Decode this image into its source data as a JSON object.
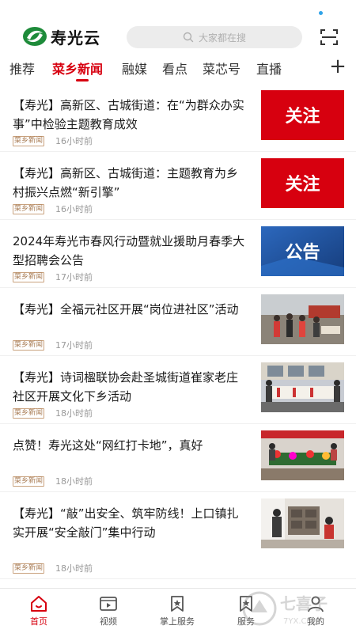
{
  "header": {
    "logo_text": "寿光云",
    "search_placeholder": "大家都在搜"
  },
  "tabs": [
    {
      "label": "推荐",
      "active": false
    },
    {
      "label": "菜乡新闻",
      "active": true
    },
    {
      "label": "融媒",
      "active": false
    },
    {
      "label": "看点",
      "active": false
    },
    {
      "label": "菜芯号",
      "active": false
    },
    {
      "label": "直播",
      "active": false
    }
  ],
  "news": [
    {
      "title": "【寿光】高新区、古城街道：在“为群众办实事”中检验主题教育成效",
      "tag": "菜乡新闻",
      "time": "16小时前",
      "thumb_text": "关注"
    },
    {
      "title": "【寿光】高新区、古城街道：主题教育为乡村振兴点燃“新引擎”",
      "tag": "菜乡新闻",
      "time": "16小时前",
      "thumb_text": "关注"
    },
    {
      "title": "2024年寿光市春风行动暨就业援助月春季大型招聘会公告",
      "tag": "菜乡新闻",
      "time": "17小时前",
      "thumb_text": "公告"
    },
    {
      "title": "【寿光】全福元社区开展“岗位进社区”活动",
      "tag": "菜乡新闻",
      "time": "17小时前",
      "thumb_text": ""
    },
    {
      "title": "【寿光】诗词楹联协会赴圣城街道崔家老庄社区开展文化下乡活动",
      "tag": "菜乡新闻",
      "time": "18小时前",
      "thumb_text": ""
    },
    {
      "title": "点赞！寿光这处“网红打卡地”，真好",
      "tag": "菜乡新闻",
      "time": "18小时前",
      "thumb_text": ""
    },
    {
      "title": "【寿光】“敲”出安全、筑牢防线！上口镇扎实开展“安全敲门”集中行动",
      "tag": "菜乡新闻",
      "time": "18小时前",
      "thumb_text": ""
    }
  ],
  "bottom_nav": [
    {
      "label": "首页",
      "active": true
    },
    {
      "label": "视频",
      "active": false
    },
    {
      "label": "掌上服务",
      "active": false
    },
    {
      "label": "服务",
      "active": false
    },
    {
      "label": "我的",
      "active": false
    }
  ],
  "watermark": "七喜子",
  "watermark_url": "7YX.COM",
  "colors": {
    "accent": "#d7000f",
    "notice_blue": "#1f4f9a",
    "tag_border": "#c9a27e"
  }
}
